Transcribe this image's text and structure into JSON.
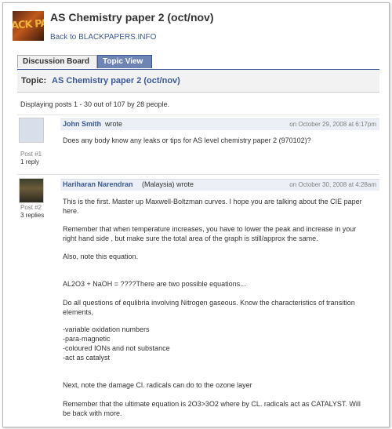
{
  "header": {
    "logo_text": "ACK PAPERS",
    "title": "AS Chemistry paper 2 (oct/nov)",
    "back_link": "Back to BLACKPAPERS.INFO"
  },
  "tabs": [
    {
      "label": "Discussion Board",
      "active": false
    },
    {
      "label": "Topic View",
      "active": true
    }
  ],
  "topic": {
    "label": "Topic:",
    "title": "AS Chemistry paper 2 (oct/nov)"
  },
  "displaying": "Displaying posts 1 - 30 out of 107 by 28 people.",
  "posts": [
    {
      "author": "John Smith",
      "wrote": "wrote",
      "date": "on October 29, 2008 at 6:17pm",
      "post_number": "Post #1",
      "replies": "1 reply",
      "lines": [
        "Does any body know any leaks or tips for AS level chemistry paper 2 (970102)?"
      ]
    },
    {
      "author": "Hariharan Narendran",
      "wrote": "(Malaysia) wrote",
      "date": "on October 30, 2008 at 4:28am",
      "post_number": "Post #2",
      "replies": "3 replies",
      "lines": [
        "This is the first. Master up Maxwell-Boltzman curves. I hope you are talking about the CIE paper",
        "here.",
        "Remember that when temperature increases, you have to lower the peak and increase in your",
        "right hand side , but make sure the total area of the graph is still/approx the same.",
        "Also, note this equation.",
        "AL2O3 + NaOH = ????There are two possible equations...",
        "Do all questions of equlibria involving Nitrogen gaseous. Know the characteristics of transition",
        "elements,",
        "-variable oxidation numbers",
        "-para-magnetic",
        "-coloured IONs and not substance",
        "-act as catalyst",
        "Next, note the damage Cl. radicals can do to the ozone layer",
        "Remember that the ultimate equation is 2O3>3O2 where by CL. radicals act as CATALYST. Will",
        "be back with more."
      ]
    }
  ]
}
